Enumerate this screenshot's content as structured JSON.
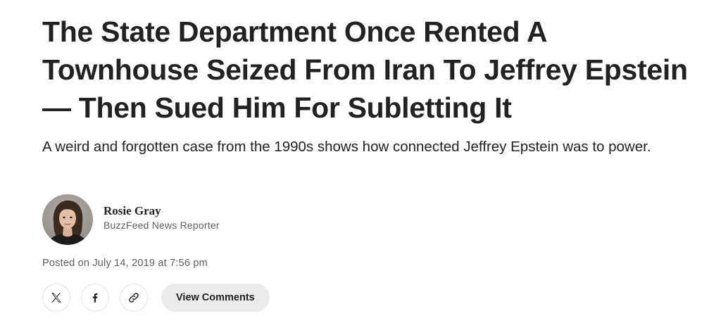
{
  "article": {
    "headline": "The State Department Once Rented A Townhouse Seized From Iran To Jeffrey Epstein — Then Sued Him For Subletting It",
    "dek": "A weird and forgotten case from the 1990s shows how connected Jeffrey Epstein was to power."
  },
  "author": {
    "name": "Rosie Gray",
    "role": "BuzzFeed News Reporter",
    "avatar_icon": "author-photo"
  },
  "posted": {
    "text": "Posted on July 14, 2019 at 7:56 pm"
  },
  "share": {
    "icons": [
      "x-logo-icon",
      "facebook-icon",
      "link-icon"
    ],
    "comments_label": "View Comments"
  },
  "colors": {
    "text": "#222222",
    "muted": "#5e5e5e",
    "button_bg": "#ebebeb",
    "border": "#e2e2e2"
  }
}
